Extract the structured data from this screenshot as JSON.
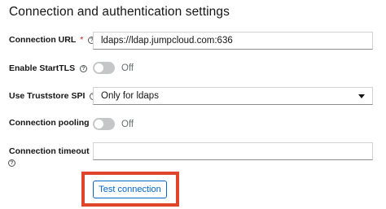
{
  "section": {
    "title": "Connection and authentication settings"
  },
  "fields": {
    "connection_url": {
      "label": "Connection URL",
      "required_mark": "*",
      "help_glyph": "?",
      "value": "ldaps://ldap.jumpcloud.com:636"
    },
    "enable_starttls": {
      "label": "Enable StartTLS",
      "help_glyph": "?",
      "state": "Off"
    },
    "use_truststore_spi": {
      "label": "Use Truststore SPI",
      "help_glyph": "?",
      "selected": "Only for ldaps"
    },
    "connection_pooling": {
      "label": "Connection pooling",
      "help_glyph": "?",
      "state": "Off"
    },
    "connection_timeout": {
      "label": "Connection timeout",
      "help_glyph": "?",
      "value": ""
    }
  },
  "actions": {
    "test_connection_label": "Test connection"
  },
  "colors": {
    "accent": "#0066cc",
    "required": "#c9190b",
    "highlight_box": "#e0452b",
    "toggle_off": "#c4c6c8"
  },
  "icons": {
    "help": "help-circle-icon",
    "select_caret": "caret-down-icon"
  }
}
